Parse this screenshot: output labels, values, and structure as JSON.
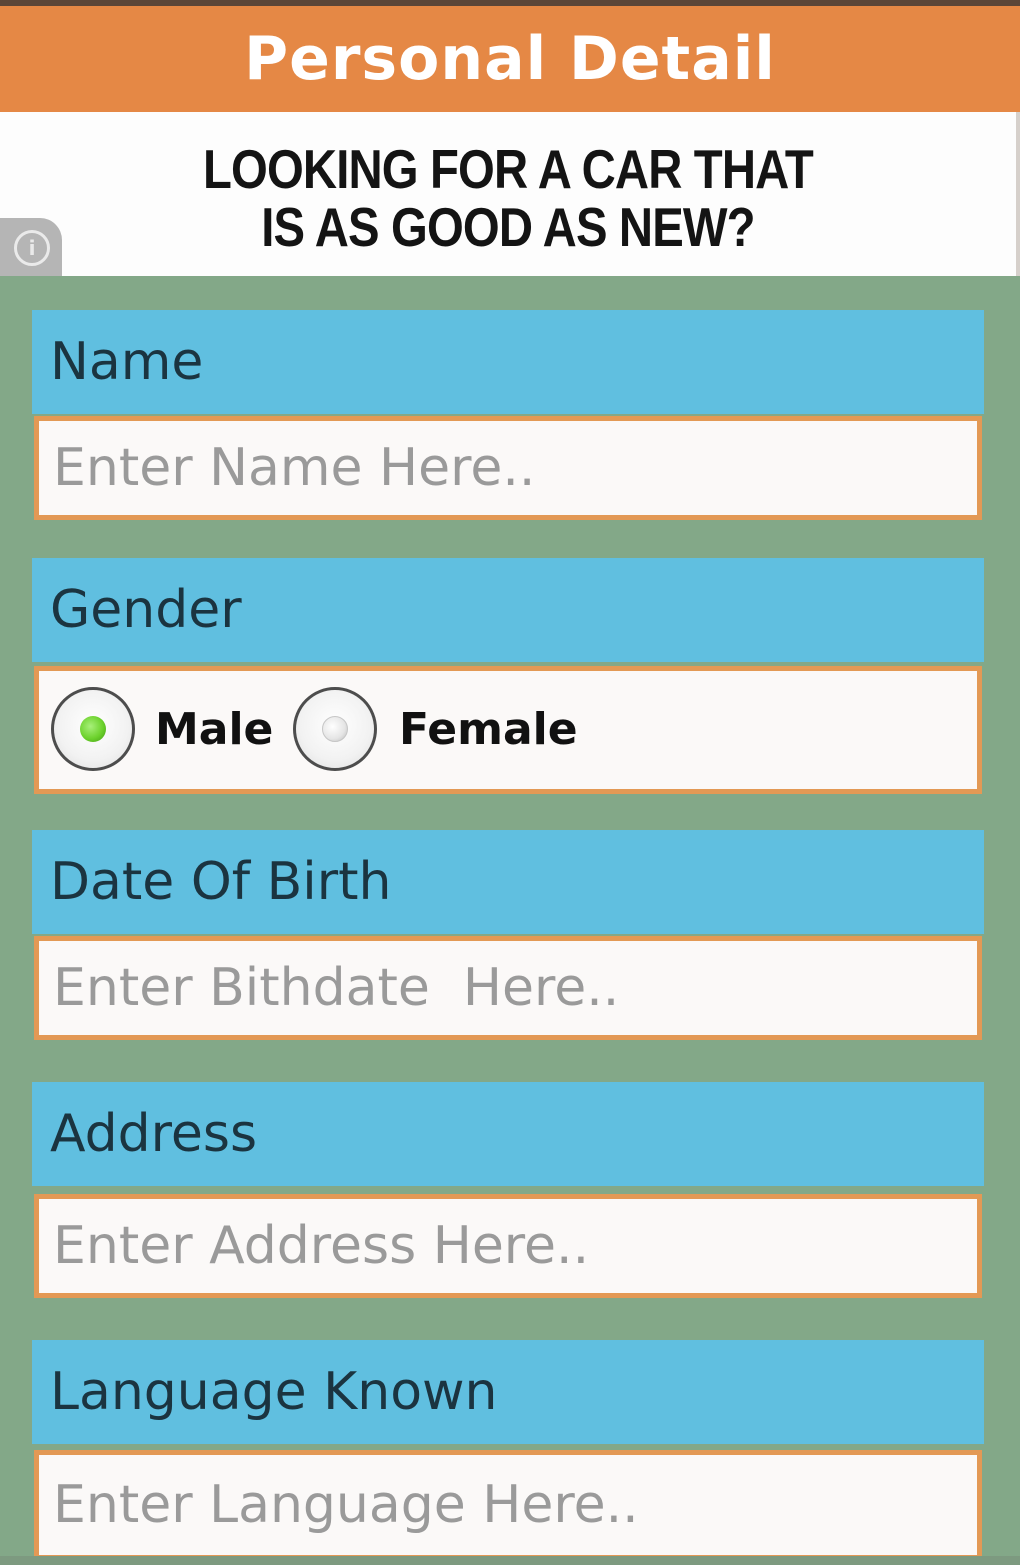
{
  "header": {
    "title": "Personal Detail"
  },
  "ad": {
    "line1": "LOOKING FOR A CAR THAT",
    "line2": "IS AS GOOD AS NEW?",
    "info_glyph": "i"
  },
  "form": {
    "name": {
      "label": "Name",
      "placeholder": "Enter Name Here..",
      "value": ""
    },
    "gender": {
      "label": "Gender",
      "options": [
        {
          "label": "Male",
          "checked": true
        },
        {
          "label": "Female",
          "checked": false
        }
      ]
    },
    "dob": {
      "label": "Date Of Birth",
      "placeholder": "Enter Bithdate  Here..",
      "value": ""
    },
    "address": {
      "label": "Address",
      "placeholder": "Enter Address Here..",
      "value": ""
    },
    "language": {
      "label": "Language Known",
      "placeholder": "Enter Language Here..",
      "value": ""
    }
  },
  "colors": {
    "header_bg": "#e58845",
    "page_bg": "#83a888",
    "label_bg": "#60bfe0",
    "field_border": "#e39955",
    "radio_checked": "#6dd22d"
  },
  "icons": {
    "ad_info": "info-icon"
  }
}
